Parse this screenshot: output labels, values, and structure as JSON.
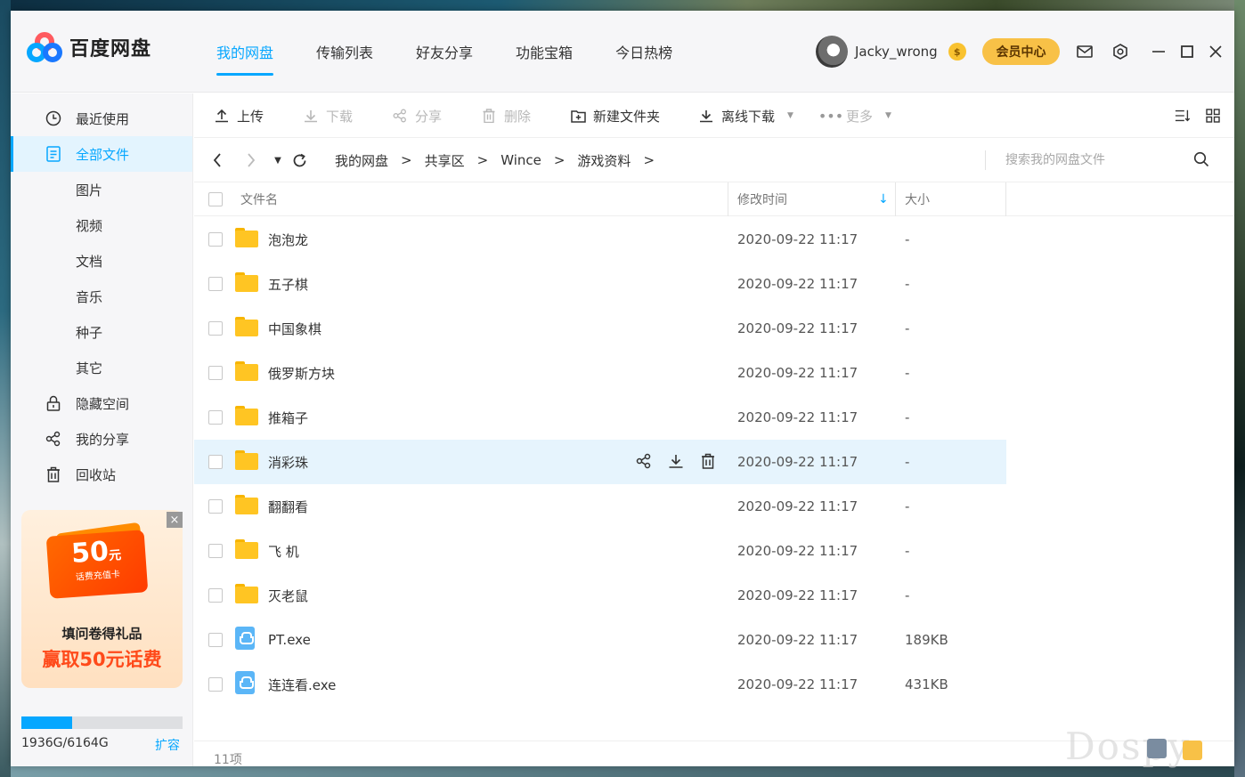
{
  "app": {
    "name": "百度网盘",
    "top_tabs": [
      "我的网盘",
      "传输列表",
      "好友分享",
      "功能宝箱",
      "今日热榜"
    ],
    "active_tab": "我的网盘",
    "username": "Jacky_wrong",
    "vip_badge": "$",
    "vip_button": "会员中心"
  },
  "sidebar": {
    "items": [
      {
        "label": "最近使用",
        "icon": "clock-icon",
        "glyph": "🕓"
      },
      {
        "label": "全部文件",
        "icon": "document-icon",
        "glyph": "🗎",
        "active": true
      },
      {
        "label": "图片",
        "icon": "",
        "glyph": ""
      },
      {
        "label": "视频",
        "icon": "",
        "glyph": ""
      },
      {
        "label": "文档",
        "icon": "",
        "glyph": ""
      },
      {
        "label": "音乐",
        "icon": "",
        "glyph": ""
      },
      {
        "label": "种子",
        "icon": "",
        "glyph": ""
      },
      {
        "label": "其它",
        "icon": "",
        "glyph": ""
      },
      {
        "label": "隐藏空间",
        "icon": "lock-icon",
        "glyph": "🔒"
      },
      {
        "label": "我的分享",
        "icon": "share-icon",
        "glyph": "⧉"
      },
      {
        "label": "回收站",
        "icon": "trash-icon",
        "glyph": "🗑"
      }
    ],
    "promo": {
      "amount": "50",
      "unit": "元",
      "card_sub": "话费充值卡",
      "line1": "填问卷得礼品",
      "line2": "赢取50元话费",
      "close": "×"
    },
    "quota": {
      "used_fraction": 0.314,
      "text": "1936G/6164G",
      "expand": "扩容"
    }
  },
  "toolbar": {
    "upload": "上传",
    "download": "下载",
    "share": "分享",
    "delete": "删除",
    "new_folder": "新建文件夹",
    "offline_download": "离线下载",
    "more": "更多"
  },
  "pathbar": {
    "crumbs": [
      "我的网盘",
      "共享区",
      "Wince",
      "游戏资料"
    ],
    "separator": ">",
    "search_placeholder": "搜索我的网盘文件"
  },
  "table": {
    "headers": {
      "name": "文件名",
      "modified": "修改时间",
      "size": "大小"
    },
    "rows": [
      {
        "name": "泡泡龙",
        "type": "folder",
        "date": "2020-09-22 11:17",
        "size": "-"
      },
      {
        "name": "五子棋",
        "type": "folder",
        "date": "2020-09-22 11:17",
        "size": "-"
      },
      {
        "name": "中国象棋",
        "type": "folder",
        "date": "2020-09-22 11:17",
        "size": "-"
      },
      {
        "name": "俄罗斯方块",
        "type": "folder",
        "date": "2020-09-22 11:17",
        "size": "-"
      },
      {
        "name": "推箱子",
        "type": "folder",
        "date": "2020-09-22 11:17",
        "size": "-"
      },
      {
        "name": "消彩珠",
        "type": "folder",
        "date": "2020-09-22 11:17",
        "size": "-",
        "hover": true
      },
      {
        "name": "翻翻看",
        "type": "folder",
        "date": "2020-09-22 11:17",
        "size": "-"
      },
      {
        "name": "飞 机",
        "type": "folder",
        "date": "2020-09-22 11:17",
        "size": "-"
      },
      {
        "name": "灭老鼠",
        "type": "folder",
        "date": "2020-09-22 11:17",
        "size": "-"
      },
      {
        "name": "PT.exe",
        "type": "exe",
        "date": "2020-09-22 11:17",
        "size": "189KB"
      },
      {
        "name": "连连看.exe",
        "type": "exe",
        "date": "2020-09-22 11:17",
        "size": "431KB"
      }
    ]
  },
  "footer": {
    "count": "11项"
  },
  "watermark": "Dospy",
  "colors": {
    "accent": "#06a7ff",
    "vip": "#f8c147",
    "folder": "#ffc523",
    "hover_row": "#e6f4fd"
  }
}
